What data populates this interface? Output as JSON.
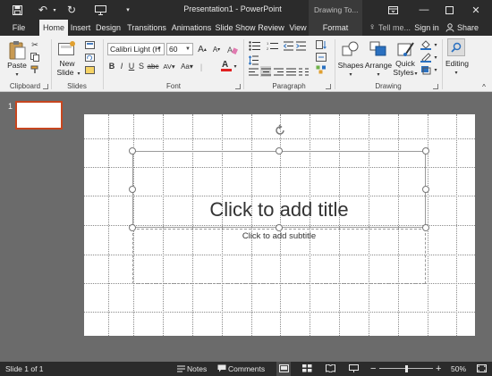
{
  "titlebar": {
    "document_title": "Presentation1 - PowerPoint",
    "contextual_tab_group": "Drawing To...",
    "icons": [
      "save-icon",
      "undo-icon",
      "redo-icon",
      "present-from-beginning-icon",
      "customize-toolbar-icon"
    ],
    "window_buttons": [
      "ribbon-display-options-icon",
      "minimize-icon",
      "maximize-icon",
      "close-icon"
    ]
  },
  "tabs": {
    "file": "File",
    "home": "Home",
    "insert": "Insert",
    "design": "Design",
    "transitions": "Transitions",
    "animations": "Animations",
    "slideshow": "Slide Show",
    "review": "Review",
    "view": "View",
    "format": "Format",
    "tell_me": "Tell me...",
    "sign_in": "Sign in",
    "share": "Share"
  },
  "ribbon": {
    "clipboard": {
      "label": "Clipboard",
      "paste": "Paste"
    },
    "slides": {
      "label": "Slides",
      "new_slide_line1": "New",
      "new_slide_line2": "Slide"
    },
    "font": {
      "label": "Font",
      "font_name": "Calibri Light (H",
      "font_size": "60"
    },
    "paragraph": {
      "label": "Paragraph"
    },
    "drawing": {
      "label": "Drawing",
      "shapes": "Shapes",
      "arrange": "Arrange",
      "quick_styles_line1": "Quick",
      "quick_styles_line2": "Styles"
    },
    "editing": {
      "label": "Editing"
    }
  },
  "thumbnails": {
    "slide_number": "1"
  },
  "slide": {
    "title_placeholder": "Click to add title",
    "subtitle_placeholder": "Click to add subtitle"
  },
  "statusbar": {
    "slide_info": "Slide 1 of 1",
    "notes": "Notes",
    "comments": "Comments",
    "zoom": "50%",
    "zoom_level": 0.5
  },
  "colors": {
    "dark_chrome": "#2b2b2b",
    "ribbon_bg": "#f1f1f1",
    "workspace_bg": "#6b6b6b",
    "selected_thumb_border": "#c6461f",
    "font_color_red": "#e02020"
  }
}
